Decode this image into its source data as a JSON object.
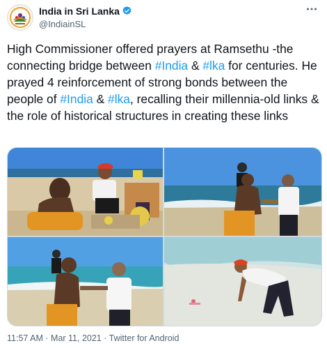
{
  "account": {
    "name": "India in Sri Lanka",
    "handle": "@IndiainSL",
    "verified": true,
    "avatar_icon": "india-embassy-logo-icon"
  },
  "tweet": {
    "segments": [
      {
        "text": "High Commissioner offered prayers at Ramsethu -the connecting bridge between ",
        "type": "text"
      },
      {
        "text": "#India",
        "type": "hashtag"
      },
      {
        "text": " & ",
        "type": "text"
      },
      {
        "text": "#lka",
        "type": "hashtag"
      },
      {
        "text": " for centuries. He prayed 4 reinforcement of strong bonds between the people of ",
        "type": "text"
      },
      {
        "text": "#India",
        "type": "hashtag"
      },
      {
        "text": " & ",
        "type": "text"
      },
      {
        "text": "#lka",
        "type": "hashtag"
      },
      {
        "text": ", recalling their millennia-old links & the role of historical structures in creating these links",
        "type": "text"
      }
    ]
  },
  "meta": {
    "time": "11:57 AM",
    "separator": "·",
    "date": "Mar 11, 2021",
    "source": "Twitter for Android"
  },
  "colors": {
    "link": "#1d9bf0",
    "secondary_text": "#536471",
    "verified": "#1d9bf0"
  }
}
